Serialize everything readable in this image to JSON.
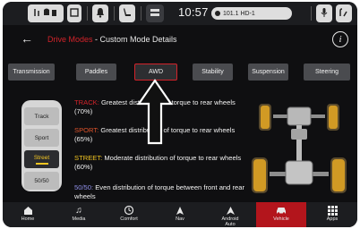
{
  "status": {
    "clock": "10:57",
    "radio": "101.1 HD-1"
  },
  "header": {
    "breadcrumb_parent": "Drive Modes",
    "breadcrumb_separator": " - ",
    "breadcrumb_current": "Custom Mode Details",
    "info_glyph": "i"
  },
  "tabs": [
    {
      "label": "Transmission"
    },
    {
      "label": "Paddles"
    },
    {
      "label": "AWD",
      "active": true
    },
    {
      "label": "Stability"
    },
    {
      "label": "Suspension"
    },
    {
      "label": "Steering"
    }
  ],
  "selector": {
    "items": [
      "Track",
      "Sport",
      "Street",
      "50/50"
    ],
    "selected": "Street"
  },
  "descriptions": [
    {
      "key": "TRACK:",
      "text": " Greatest distribution of torque to rear wheels (70%)"
    },
    {
      "key": "SPORT:",
      "text": " Greatest distribution of torque to rear wheels (65%)"
    },
    {
      "key": "STREET:",
      "text": " Moderate distribution of torque to rear wheels (60%)"
    },
    {
      "key": "50/50:",
      "text": " Even distribution of torque between front and rear wheels"
    }
  ],
  "nav": [
    {
      "label": "Home",
      "icon": "home-icon"
    },
    {
      "label": "Media",
      "icon": "music-note-icon"
    },
    {
      "label": "Comfort",
      "icon": "climate-icon"
    },
    {
      "label": "Nav",
      "icon": "navigation-arrow-icon"
    },
    {
      "label": "Android Auto",
      "icon": "android-auto-icon"
    },
    {
      "label": "Vehicle",
      "icon": "car-icon",
      "active": true
    },
    {
      "label": "Apps",
      "icon": "apps-grid-icon"
    }
  ],
  "colors": {
    "accent_red": "#d2232a",
    "street_yellow": "#f2c521",
    "sport_orange": "#e0542b",
    "even_blue": "#8f8fe8"
  }
}
